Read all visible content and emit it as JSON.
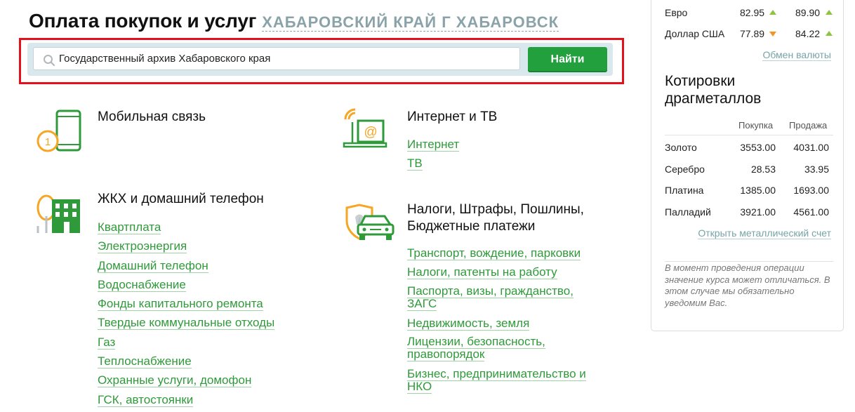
{
  "header": {
    "title": "Оплата покупок и услуг",
    "region": "ХАБАРОВСКИЙ КРАЙ Г ХАБАРОВСК"
  },
  "search": {
    "value": "Государственный архив Хабаровского края",
    "button_label": "Найти"
  },
  "categories": {
    "mobile": {
      "title": "Мобильная связь",
      "icon": "mobile-phone-icon"
    },
    "internet": {
      "title": "Интернет и ТВ",
      "icon": "laptop-wifi-icon",
      "links": [
        "Интернет",
        "ТВ"
      ]
    },
    "housing": {
      "title": "ЖКХ и домашний телефон",
      "icon": "house-icon",
      "links": [
        "Квартплата",
        "Электроэнергия",
        "Домашний телефон",
        "Водоснабжение",
        "Фонды капитального ремонта",
        "Твердые коммунальные отходы",
        "Газ",
        "Теплоснабжение",
        "Охранные услуги, домофон",
        "ГСК, автостоянки"
      ]
    },
    "taxes": {
      "title_line1": "Налоги, Штрафы, Пошлины,",
      "title_line2": "Бюджетные платежи",
      "icon": "car-shield-icon",
      "links": {
        "transport": "Транспорт, вождение, парковки",
        "taxes": "Налоги, патенты на работу",
        "passports_1": "Паспорта, визы, гражданство,",
        "passports_2": "ЗАГС",
        "realty": "Недвижимость, земля",
        "licenses_1": "Лицензии, безопасность,",
        "licenses_2": "правопорядок",
        "business_1": "Бизнес, предпринимательство и",
        "business_2": "НКО"
      }
    }
  },
  "sidebar": {
    "rates": [
      {
        "currency": "Евро",
        "buy": "82.95",
        "buy_trend": "up",
        "sell": "89.90",
        "sell_trend": "up"
      },
      {
        "currency": "Доллар США",
        "buy": "77.89",
        "buy_trend": "down",
        "sell": "84.22",
        "sell_trend": "up"
      }
    ],
    "exchange_link": "Обмен валюты",
    "metals_title_1": "Котировки",
    "metals_title_2": "драгметаллов",
    "metals_header": {
      "buy": "Покупка",
      "sell": "Продажа"
    },
    "metals": [
      {
        "name": "Золото",
        "buy": "3553.00",
        "sell": "4031.00"
      },
      {
        "name": "Серебро",
        "buy": "28.53",
        "sell": "33.95"
      },
      {
        "name": "Платина",
        "buy": "1385.00",
        "sell": "1693.00"
      },
      {
        "name": "Палладий",
        "buy": "3921.00",
        "sell": "4561.00"
      }
    ],
    "metal_account_link": "Открыть металлический счет",
    "note": "В момент проведения операции значение курса может отличаться. В этом случае мы обязательно уведомим Вас."
  },
  "colors": {
    "accent_green": "#2f9a3a",
    "button_green": "#22a03e",
    "highlight_red": "#e3111e",
    "region_gray": "#8aa3a9",
    "icon_orange": "#f5a623"
  }
}
